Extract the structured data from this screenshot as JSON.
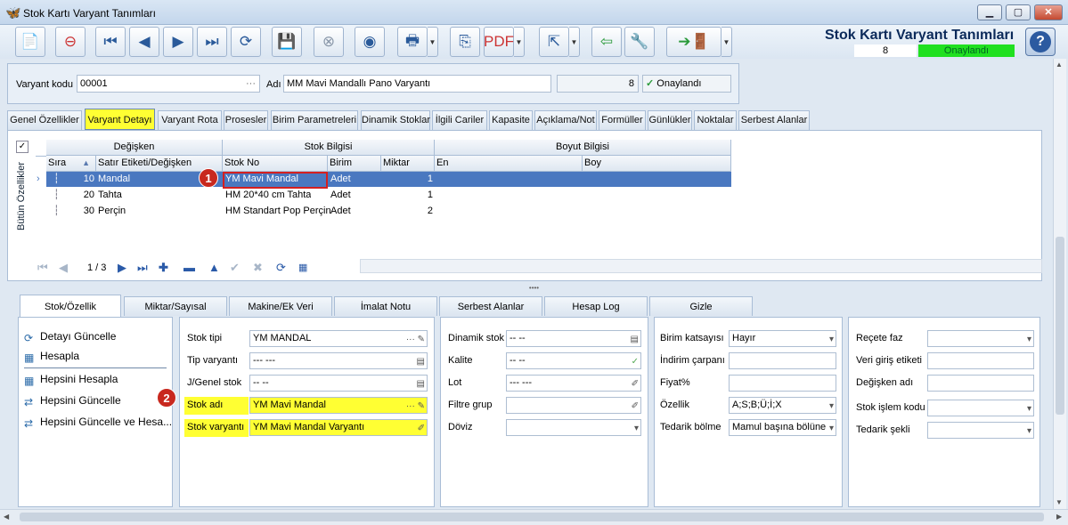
{
  "window": {
    "title": "Stok Kartı Varyant Tanımları"
  },
  "header": {
    "title": "Stok Kartı Varyant Tanımları",
    "number": "8",
    "status": "Onaylandı",
    "help": "?"
  },
  "toolbar": {
    "icons": [
      "new",
      "delete",
      "first",
      "prev",
      "next",
      "last",
      "refresh",
      "save",
      "cancel-save",
      "preview",
      "print",
      "copy",
      "pdf",
      "export",
      "import",
      "tools",
      "exit",
      "more"
    ]
  },
  "form": {
    "variant_code_label": "Varyant kodu",
    "variant_code": "00001",
    "variant_code_btn": "···",
    "name_label": "Adı",
    "name": "MM Mavi Mandallı Pano Varyantı",
    "count": "8",
    "approved_label": "Onaylandı",
    "approved_check": "✓"
  },
  "tabs": [
    "Genel Özellikler",
    "Varyant Detayı",
    "Varyant Rota",
    "Prosesler",
    "Birim Parametreleri",
    "Dinamik Stoklar",
    "İlgili Cariler",
    "Kapasite",
    "Açıklama/Not",
    "Formüller",
    "Günlükler",
    "Noktalar",
    "Serbest Alanlar"
  ],
  "grid": {
    "side_label": "Bütün Özellikler",
    "groups": {
      "degisken": "Değişken",
      "stok": "Stok Bilgisi",
      "boyut": "Boyut Bilgisi"
    },
    "columns": {
      "sira": "Sıra",
      "satir": "Satır Etiketi/Değişken",
      "stokno": "Stok No",
      "birim": "Birim",
      "miktar": "Miktar",
      "en": "En",
      "boy": "Boy"
    },
    "rows": [
      {
        "sira": "10",
        "satir": "Mandal",
        "stokno": "YM Mavi Mandal",
        "birim": "Adet",
        "miktar": "1"
      },
      {
        "sira": "20",
        "satir": "Tahta",
        "stokno": "HM 20*40 cm Tahta",
        "birim": "Adet",
        "miktar": "1"
      },
      {
        "sira": "30",
        "satir": "Perçin",
        "stokno": "HM Standart Pop Perçin",
        "birim": "Adet",
        "miktar": "2"
      }
    ],
    "pager": "1 / 3"
  },
  "badges": {
    "one": "1",
    "two": "2"
  },
  "subtabs": [
    "Stok/Özellik",
    "Miktar/Sayısal",
    "Makine/Ek Veri",
    "İmalat Notu",
    "Serbest Alanlar",
    "Hesap Log",
    "Gizle"
  ],
  "actions": [
    "Detayı Güncelle",
    "Hesapla",
    "Hepsini Hesapla",
    "Hepsini Güncelle",
    "Hepsini Güncelle ve Hesa..."
  ],
  "fields1": {
    "stok_tipi_label": "Stok tipi",
    "stok_tipi": "YM MANDAL",
    "tip_varyanti_label": "Tip varyantı",
    "tip_varyanti": "--- ---",
    "jgenel_label": "J/Genel stok",
    "jgenel": "-- --",
    "stok_adi_label": "Stok adı",
    "stok_adi": "YM Mavi Mandal",
    "stok_varyanti_label": "Stok varyantı",
    "stok_varyanti": "YM Mavi Mandal Varyantı",
    "dots": "···"
  },
  "fields2": {
    "dinamik_label": "Dinamik stok",
    "dinamik": "-- --",
    "kalite_label": "Kalite",
    "kalite": "-- --",
    "lot_label": "Lot",
    "lot": "--- ---",
    "filtre_label": "Filtre grup",
    "filtre": "",
    "doviz_label": "Döviz",
    "doviz": ""
  },
  "fields3": {
    "birim_label": "Birim katsayısı",
    "birim": "Hayır",
    "indirim_label": "İndirim çarpanı",
    "indirim": "",
    "fiyat_label": "Fiyat%",
    "fiyat": "",
    "ozellik_label": "Özellik",
    "ozellik": "A;S;B;Ü;İ;X",
    "tedarik_label": "Tedarik bölme",
    "tedarik": "Mamul başına bölüne"
  },
  "fields4": {
    "recete_label": "Reçete faz",
    "recete": "",
    "veri_label": "Veri giriş etiketi",
    "veri": "",
    "degisken_label": "Değişken adı",
    "degisken": "",
    "islem_label": "Stok işlem kodu",
    "islem": "",
    "sekli_label": "Tedarik şekli",
    "sekli": ""
  }
}
